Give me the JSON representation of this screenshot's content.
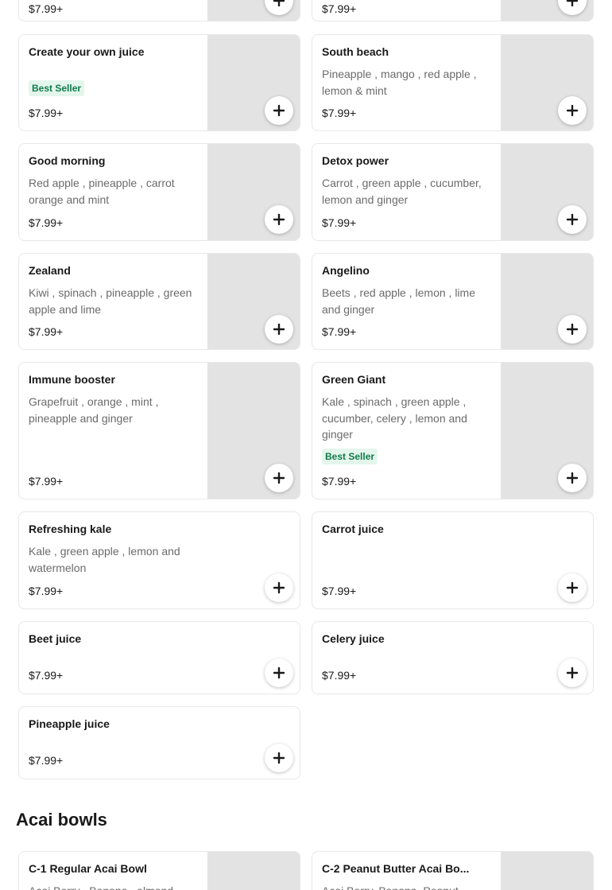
{
  "top_row": {
    "left_price": "$7.99+",
    "right_price": "$7.99+"
  },
  "items": [
    {
      "title": "Create your own juice",
      "desc": "",
      "badge": "Best Seller",
      "price": "$7.99+"
    },
    {
      "title": "South beach",
      "desc": "Pineapple , mango , red apple , lemon & mint",
      "badge": "",
      "price": "$7.99+"
    },
    {
      "title": "Good morning",
      "desc": "Red apple , pineapple , carrot orange and mint",
      "badge": "",
      "price": "$7.99+"
    },
    {
      "title": "Detox power",
      "desc": "Carrot , green apple , cucumber, lemon and ginger",
      "badge": "",
      "price": "$7.99+"
    },
    {
      "title": "Zealand",
      "desc": "Kiwi , spinach , pineapple , green apple and lime",
      "badge": "",
      "price": "$7.99+"
    },
    {
      "title": "Angelino",
      "desc": "Beets , red apple , lemon , lime and ginger",
      "badge": "",
      "price": "$7.99+"
    },
    {
      "title": "Immune booster",
      "desc": "Grapefruit , orange , mint , pineapple and ginger",
      "badge": "",
      "price": "$7.99+"
    },
    {
      "title": "Green Giant",
      "desc": "Kale , spinach , green apple , cucumber, celery , lemon and ginger",
      "badge": "Best Seller",
      "price": "$7.99+"
    },
    {
      "title": "Refreshing kale",
      "desc": "Kale , green apple , lemon and watermelon",
      "badge": "",
      "price": "$7.99+"
    },
    {
      "title": "Carrot juice",
      "desc": "",
      "badge": "",
      "price": "$7.99+"
    },
    {
      "title": "Beet juice",
      "desc": "",
      "badge": "",
      "price": "$7.99+"
    },
    {
      "title": "Celery juice",
      "desc": "",
      "badge": "",
      "price": "$7.99+"
    },
    {
      "title": "Pineapple juice",
      "desc": "",
      "badge": "",
      "price": "$7.99+"
    }
  ],
  "section": {
    "title": "Acai bowls",
    "items": [
      {
        "title": "C-1 Regular Acai Bowl",
        "desc": "Acai Berry , Banana , almond"
      },
      {
        "title": "C-2 Peanut Butter Acai Bo...",
        "desc": "Acai Berry, Banana, Peanut"
      }
    ]
  },
  "icons": {
    "add": "plus-icon"
  },
  "colors": {
    "badge_text": "#117a4a",
    "badge_bg": "#e4f6ec",
    "thumb": "#e3e3e3"
  }
}
